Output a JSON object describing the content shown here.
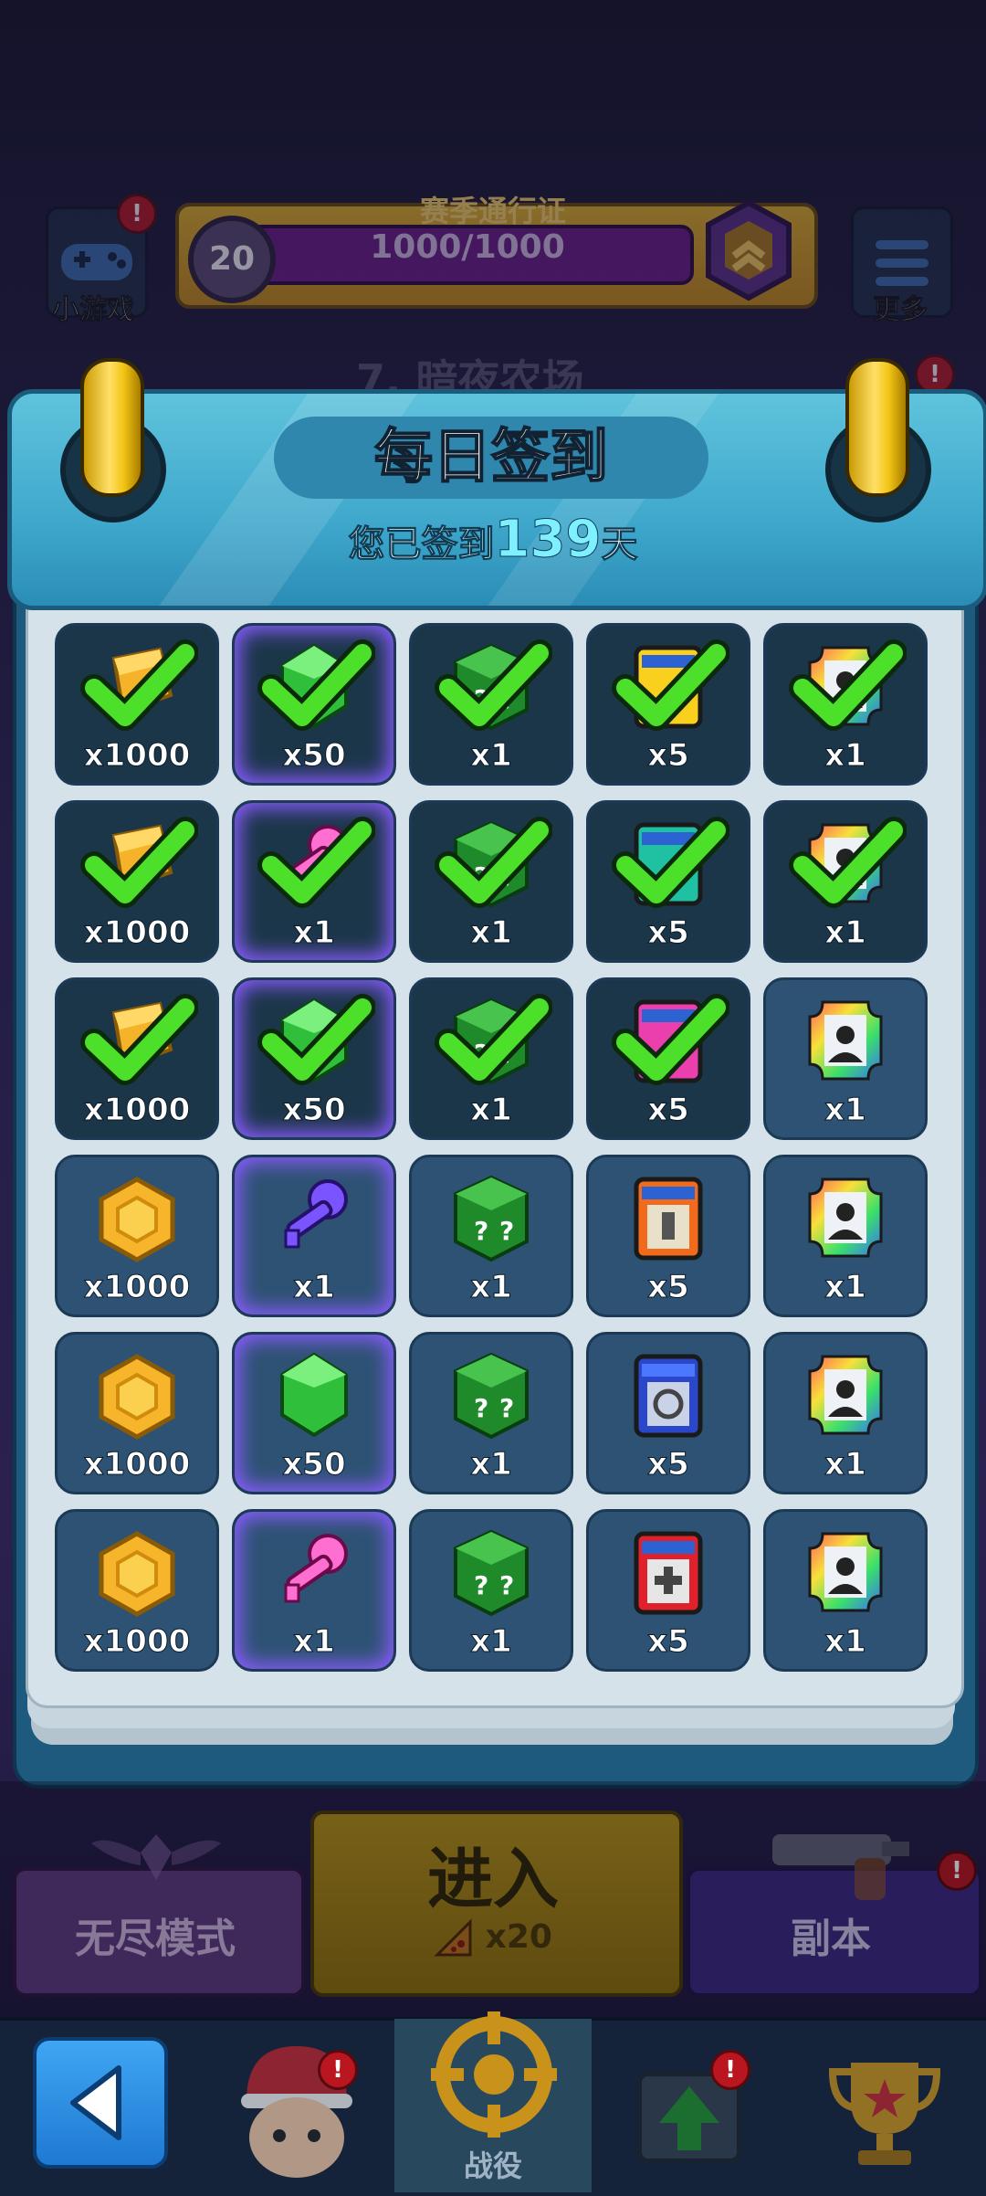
{
  "hud": {
    "minigame_label": "小游戏",
    "more_label": "更多",
    "pass_title": "赛季通行证",
    "pass_level": "20",
    "pass_progress": "1000/1000",
    "stage_title": "7. 暗夜农场",
    "alert_mark": "!"
  },
  "calendar": {
    "title": "每日签到",
    "sub_prefix": "您已签到",
    "days": "139",
    "sub_suffix": "天"
  },
  "rewards": [
    [
      {
        "icon": "gold-bar",
        "qty": "x1000",
        "claimed": true,
        "glow": false
      },
      {
        "icon": "green-gem",
        "qty": "x50",
        "claimed": true,
        "glow": true
      },
      {
        "icon": "mystery-cube",
        "qty": "x1",
        "claimed": true,
        "glow": false
      },
      {
        "icon": "yellow-card",
        "qty": "x5",
        "claimed": true,
        "glow": false
      },
      {
        "icon": "avatar-frame",
        "qty": "x1",
        "claimed": true,
        "glow": false
      }
    ],
    [
      {
        "icon": "gold-bar",
        "qty": "x1000",
        "claimed": true,
        "glow": false
      },
      {
        "icon": "pink-key",
        "qty": "x1",
        "claimed": true,
        "glow": true
      },
      {
        "icon": "mystery-cube",
        "qty": "x1",
        "claimed": true,
        "glow": false
      },
      {
        "icon": "teal-card",
        "qty": "x5",
        "claimed": true,
        "glow": false
      },
      {
        "icon": "avatar-frame",
        "qty": "x1",
        "claimed": true,
        "glow": false
      }
    ],
    [
      {
        "icon": "gold-bar",
        "qty": "x1000",
        "claimed": true,
        "glow": false
      },
      {
        "icon": "green-gem",
        "qty": "x50",
        "claimed": true,
        "glow": true
      },
      {
        "icon": "mystery-cube",
        "qty": "x1",
        "claimed": true,
        "glow": false
      },
      {
        "icon": "pink-card",
        "qty": "x5",
        "claimed": true,
        "glow": false
      },
      {
        "icon": "avatar-frame",
        "qty": "x1",
        "claimed": false,
        "glow": false
      }
    ],
    [
      {
        "icon": "gold-coin",
        "qty": "x1000",
        "claimed": false,
        "glow": false
      },
      {
        "icon": "purple-key",
        "qty": "x1",
        "claimed": false,
        "glow": true
      },
      {
        "icon": "mystery-cube",
        "qty": "x1",
        "claimed": false,
        "glow": false
      },
      {
        "icon": "orange-card",
        "qty": "x5",
        "claimed": false,
        "glow": false
      },
      {
        "icon": "avatar-frame",
        "qty": "x1",
        "claimed": false,
        "glow": false
      }
    ],
    [
      {
        "icon": "gold-coin",
        "qty": "x1000",
        "claimed": false,
        "glow": false
      },
      {
        "icon": "green-gem",
        "qty": "x50",
        "claimed": false,
        "glow": true
      },
      {
        "icon": "mystery-cube",
        "qty": "x1",
        "claimed": false,
        "glow": false
      },
      {
        "icon": "blue-card",
        "qty": "x5",
        "claimed": false,
        "glow": false
      },
      {
        "icon": "avatar-frame",
        "qty": "x1",
        "claimed": false,
        "glow": false
      }
    ],
    [
      {
        "icon": "gold-coin",
        "qty": "x1000",
        "claimed": false,
        "glow": false
      },
      {
        "icon": "pink-key",
        "qty": "x1",
        "claimed": false,
        "glow": true
      },
      {
        "icon": "mystery-cube",
        "qty": "x1",
        "claimed": false,
        "glow": false
      },
      {
        "icon": "red-card",
        "qty": "x5",
        "claimed": false,
        "glow": false
      },
      {
        "icon": "avatar-frame",
        "qty": "x1",
        "claimed": false,
        "glow": false
      }
    ]
  ],
  "bottom": {
    "endless_label": "无尽模式",
    "enter_label": "进入",
    "enter_cost": "x20",
    "dungeon_label": "副本"
  },
  "nav": {
    "campaign_label": "战役"
  }
}
